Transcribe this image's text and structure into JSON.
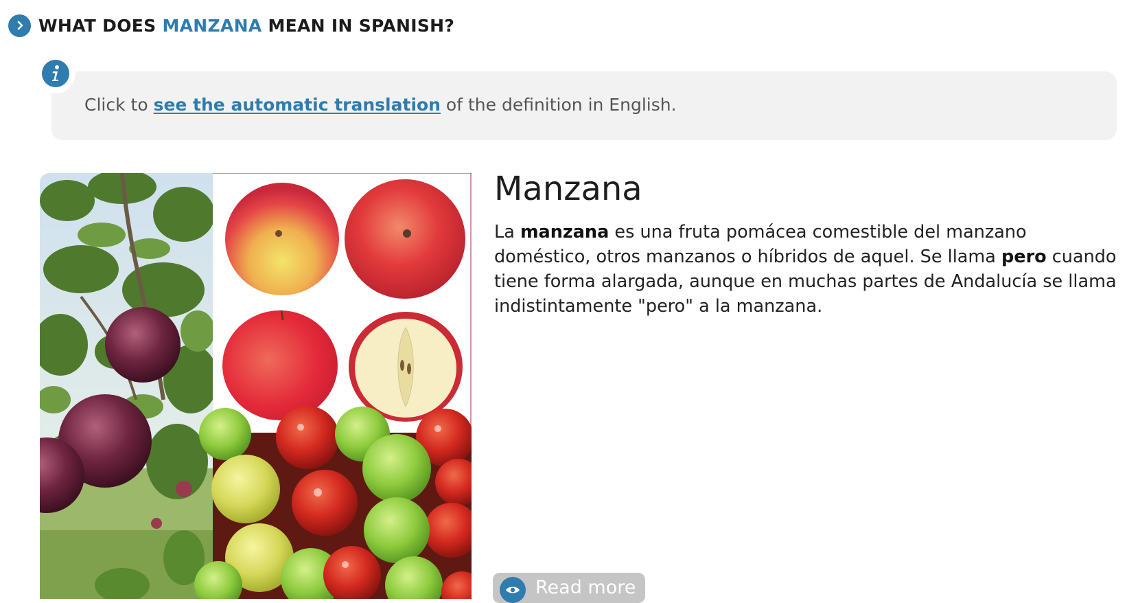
{
  "section": {
    "heading_prefix": "WHAT DOES ",
    "heading_word": "MANZANA",
    "heading_suffix": " MEAN IN SPANISH?"
  },
  "info": {
    "prefix": "Click to ",
    "link": "see the automatic translation",
    "suffix": " of the definition in English."
  },
  "entry": {
    "title": "Manzana",
    "def_p1": "La ",
    "def_b1": "manzana",
    "def_p2": " es una fruta pomácea comestible del manzano doméstico, otros manzanos o híbridos de aquel. Se llama ",
    "def_b2": "pero",
    "def_p3": " cuando tiene forma alargada, aunque en muchas partes de Andalucía se llama indistintamente \"pero\" a la manzana."
  },
  "read_more": {
    "label": "Read more"
  },
  "colors": {
    "accent": "#2f7cae",
    "info_bg": "#f2f2f2",
    "button_bg": "#c5c5c5"
  },
  "icons": {
    "heading": "chevron-right-icon",
    "info": "info-icon",
    "read_more": "eye-icon"
  }
}
